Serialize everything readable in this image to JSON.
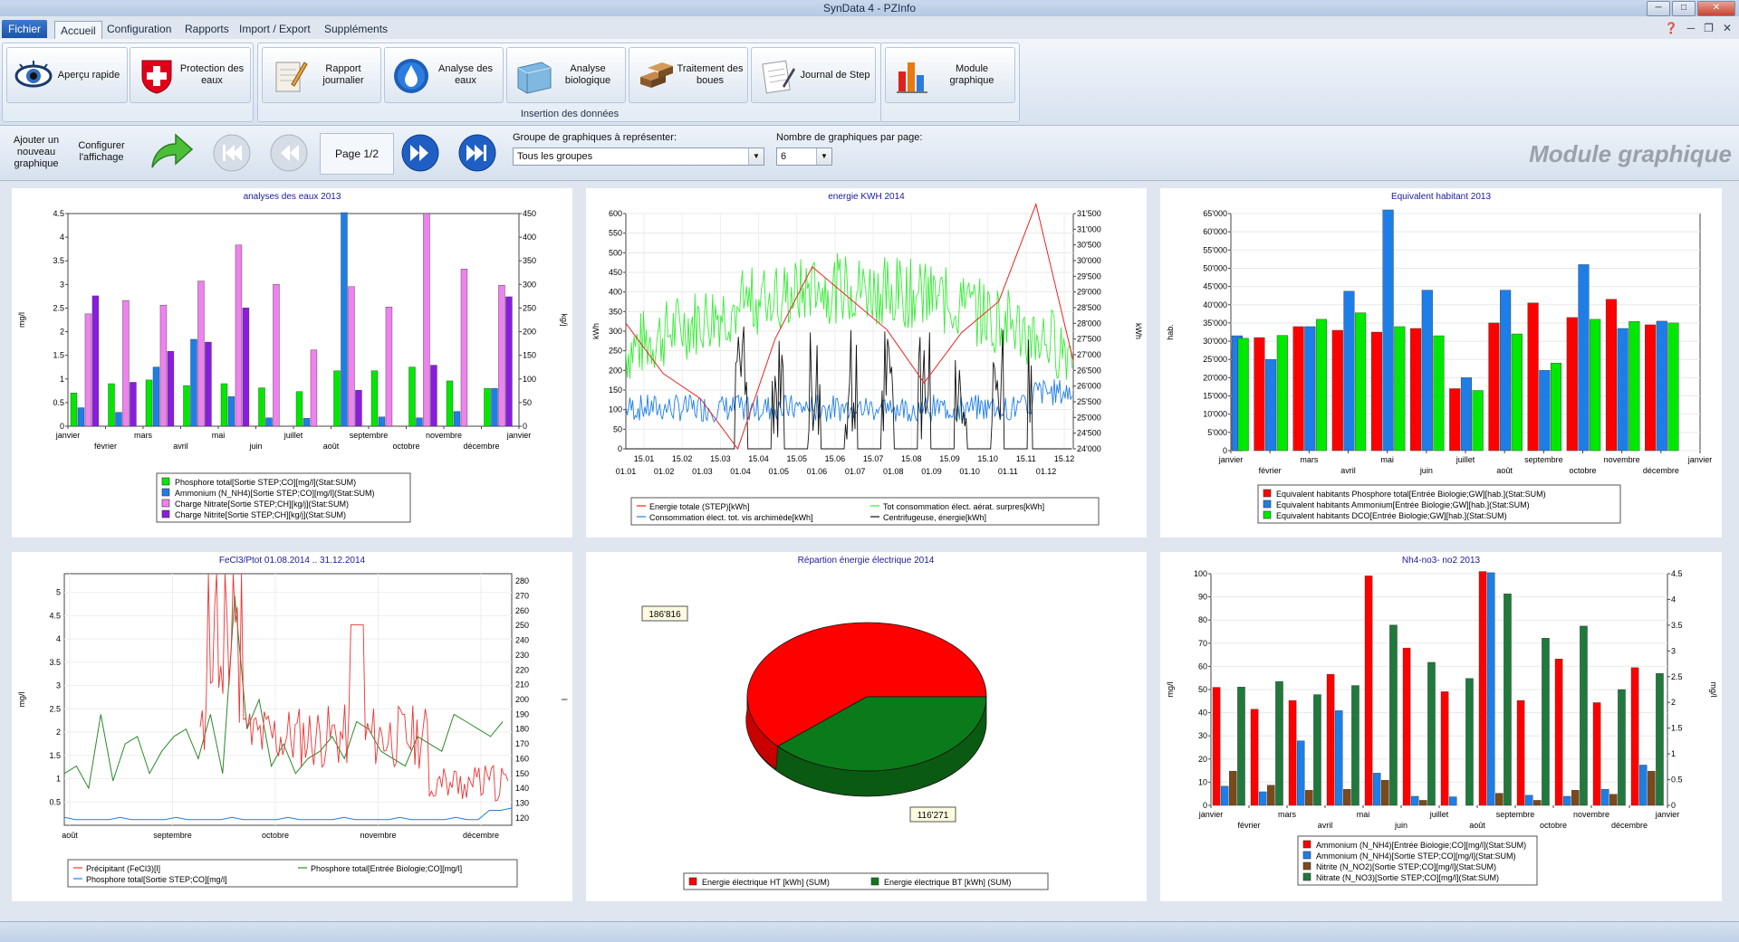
{
  "window": {
    "title": "SynData 4 - PZInfo"
  },
  "menu": {
    "file": "Fichier",
    "tabs": [
      "Accueil",
      "Configuration",
      "Rapports",
      "Import / Export",
      "Suppléments"
    ]
  },
  "ribbon": {
    "buttons": [
      {
        "label": "Aperçu rapide",
        "icon": "eye-icon"
      },
      {
        "label": "Protection des eaux",
        "icon": "swiss-cross-icon"
      },
      {
        "label": "Rapport journalier",
        "icon": "notepad-icon"
      },
      {
        "label": "Analyse des eaux",
        "icon": "water-drop-icon"
      },
      {
        "label": "Analyse biologique",
        "icon": "aquarium-icon"
      },
      {
        "label": "Traitement des boues",
        "icon": "sludge-bricks-icon"
      },
      {
        "label": "Journal de Step",
        "icon": "journal-icon"
      },
      {
        "label": "Module graphique",
        "icon": "bar-chart-icon"
      }
    ],
    "group_label": "Insertion des données"
  },
  "toolbar": {
    "add_chart": "Ajouter un nouveau graphique",
    "configure": "Configurer l'affichage",
    "page": "Page 1/2",
    "group_label": "Groupe de graphiques à représenter:",
    "group_value": "Tous les groupes",
    "count_label": "Nombre de graphiques par page:",
    "count_value": "6",
    "module_title": "Module graphique"
  },
  "colors": {
    "red": "#ff0000",
    "blue": "#1e7ee8",
    "green": "#00e800",
    "pink": "#ee82ee",
    "purple": "#8a1ce0",
    "darkgreen": "#1f7a3c",
    "brown": "#7a4a1a"
  },
  "chart_data": [
    {
      "type": "bar",
      "title": "analyses des eaux 2013",
      "ylabel": "mg/l",
      "y2label": "kg/j",
      "ylim": [
        0,
        4.6
      ],
      "y2lim": [
        0,
        460
      ],
      "categories": [
        "janvier",
        "février",
        "mars",
        "avril",
        "mai",
        "juin",
        "juillet",
        "août",
        "septembre",
        "octobre",
        "novembre",
        "décembre"
      ],
      "extra_tick": "janvier",
      "series": [
        {
          "name": "Phosphore total[Sortie STEP;CO][mg/l](Stat:SUM)",
          "axis": "left",
          "values": [
            0.72,
            0.92,
            1.0,
            0.88,
            0.92,
            0.83,
            0.75,
            1.2,
            1.2,
            1.28,
            0.98,
            0.82
          ]
        },
        {
          "name": "Ammonium (N_NH4)[Sortie STEP;CO][mg/l](Stat:SUM)",
          "axis": "left",
          "values": [
            0.4,
            0.3,
            1.28,
            1.88,
            0.64,
            0.18,
            0.17,
            4.62,
            0.2,
            0.18,
            0.32,
            0.82
          ]
        },
        {
          "name": "Charge Nitrate[Sortie STEP;CH][kg/j](Stat:SUM)",
          "axis": "right",
          "values": [
            243,
            272,
            262,
            314,
            392,
            307,
            165,
            302,
            258,
            460,
            340,
            305
          ]
        },
        {
          "name": "Charge Nitrite[Sortie STEP;CH][kg/j](Stat:SUM)",
          "axis": "right",
          "values": [
            282,
            95,
            162,
            182,
            256,
            0,
            0,
            78,
            0,
            132,
            0,
            280
          ]
        }
      ]
    },
    {
      "type": "line",
      "title": "energie KWH 2014",
      "ylabel": "kWh",
      "y2label": "kWh",
      "ylim": [
        0,
        600
      ],
      "y2lim": [
        24000,
        31500
      ],
      "x_ticks_top": [
        "15.01",
        "15.02",
        "15.03",
        "15.04",
        "15.05",
        "15.06",
        "15.07",
        "15.08",
        "15.09",
        "15.10",
        "15.11",
        "15.12"
      ],
      "x_ticks_bottom": [
        "01.01",
        "01.02",
        "01.03",
        "01.04",
        "01.05",
        "01.06",
        "01.07",
        "01.08",
        "01.09",
        "01.10",
        "01.11",
        "01.12"
      ],
      "series": [
        {
          "name": "Energie totale (STEP)[kWh]",
          "axis": "right",
          "values": [
            28000,
            26400,
            25600,
            24000,
            27500,
            29800,
            28800,
            27800,
            26100,
            27700,
            28700,
            31800,
            26800
          ]
        },
        {
          "name": "Tot consommation élect. aérat. surpres[kWh]",
          "axis": "left",
          "note": "dense daily series, about 180-580"
        },
        {
          "name": "Consommation élect. tot. vis archimède[kWh]",
          "axis": "left",
          "note": "dense daily series, about 40-200"
        },
        {
          "name": "Centrifugeuse, énergie[kWh]",
          "axis": "left",
          "note": "intermittent spikes 0-330"
        }
      ]
    },
    {
      "type": "bar",
      "title": "Equivalent habitant 2013",
      "ylabel": "hab.",
      "ylim": [
        0,
        65000
      ],
      "categories": [
        "janvier",
        "février",
        "mars",
        "avril",
        "mai",
        "juin",
        "juillet",
        "août",
        "septembre",
        "octobre",
        "novembre",
        "décembre"
      ],
      "extra_tick": "janvier",
      "series": [
        {
          "name": "Equivalent habitants Phosphore total[Entrée Biologie;GW][hab.](Stat:SUM)",
          "values": [
            27500,
            31000,
            34000,
            33000,
            32500,
            33500,
            17000,
            35000,
            40500,
            36500,
            41500,
            34500
          ]
        },
        {
          "name": "Equivalent habitants Ammonium[Entrée Biologie;GW][hab.](Stat:SUM)",
          "values": [
            31500,
            25000,
            34000,
            43700,
            66000,
            44000,
            20000,
            44000,
            22000,
            51000,
            33500,
            35500
          ]
        },
        {
          "name": "Equivalent habitants DCO[Entrée Biologie;GW][hab.](Stat:SUM)",
          "values": [
            30800,
            31600,
            36000,
            37800,
            34000,
            31500,
            16500,
            32000,
            24000,
            36000,
            35400,
            35000
          ]
        }
      ]
    },
    {
      "type": "line",
      "title": "FeCl3/Ptot 01.08.2014 .. 31.12.2014",
      "ylabel": "mg/l",
      "y2label": "l",
      "ylim": [
        0,
        5.4
      ],
      "y2lim": [
        115,
        285
      ],
      "x_ticks": [
        "août",
        "septembre",
        "octobre",
        "novembre",
        "décembre"
      ],
      "series": [
        {
          "name": "Précipitant (FeCl3)[l]",
          "axis": "right",
          "note": "mostly 0.5-2.5 mg/l scale with peaks near 5.4 in October"
        },
        {
          "name": "Phosphore total[Entrée Biologie;CO][mg/l]",
          "axis": "right",
          "values": [
            150,
            155,
            140,
            190,
            145,
            170,
            175,
            150,
            165,
            175,
            180,
            160,
            190,
            150,
            270,
            180,
            200,
            155,
            170,
            150,
            160,
            165,
            175,
            160,
            185,
            180,
            165,
            160,
            155,
            175,
            170,
            165,
            190,
            185,
            180,
            175,
            185
          ]
        },
        {
          "name": "Phosphore total[Sortie STEP;CO][mg/l]",
          "axis": "left",
          "note": "flat near 0.1-0.2"
        }
      ]
    },
    {
      "type": "pie",
      "title": "Répartion énergie électrique 2014",
      "slices": [
        {
          "name": "Energie électrique HT [kWh] (SUM)",
          "value": 186816,
          "label": "186'816"
        },
        {
          "name": "Energie électrique BT [kWh] (SUM)",
          "value": 116271,
          "label": "116'271"
        }
      ]
    },
    {
      "type": "bar",
      "title": "Nh4-no3- no2 2013",
      "ylabel": "mg/l",
      "y2label": "mg/l",
      "ylim": [
        0,
        106
      ],
      "y2lim": [
        0,
        4.6
      ],
      "categories": [
        "janvier",
        "février",
        "mars",
        "avril",
        "mai",
        "juin",
        "juillet",
        "août",
        "septembre",
        "octobre",
        "novembre",
        "décembre"
      ],
      "extra_tick": "janvier",
      "series": [
        {
          "name": "Ammonium (N_NH4)[Entrée Biologie;CO][mg/l](Stat:SUM)",
          "axis": "left",
          "values": [
            54,
            44,
            48,
            60,
            105,
            72,
            52,
            107,
            48,
            67,
            47,
            63
          ]
        },
        {
          "name": "Ammonium (N_NH4)[Sortie STEP;CO][mg/l](Stat:SUM)",
          "axis": "right",
          "values": [
            0.38,
            0.27,
            1.28,
            1.88,
            0.64,
            0.18,
            0.17,
            4.62,
            0.2,
            0.18,
            0.32,
            0.8
          ]
        },
        {
          "name": "Nitrite (N_NO2)[Sortie STEP;CO][mg/l](Stat:SUM)",
          "axis": "right",
          "values": [
            0.68,
            0.4,
            0.3,
            0.32,
            0.5,
            0.1,
            0.0,
            0.24,
            0.1,
            0.3,
            0.22,
            0.68
          ]
        },
        {
          "name": "Nitrate (N_NO3)[Sortie STEP;CO][mg/l](Stat:SUM)",
          "axis": "right",
          "values": [
            2.35,
            2.46,
            2.2,
            2.38,
            3.58,
            2.84,
            2.52,
            4.2,
            3.32,
            3.56,
            2.3,
            2.62
          ]
        }
      ]
    }
  ]
}
